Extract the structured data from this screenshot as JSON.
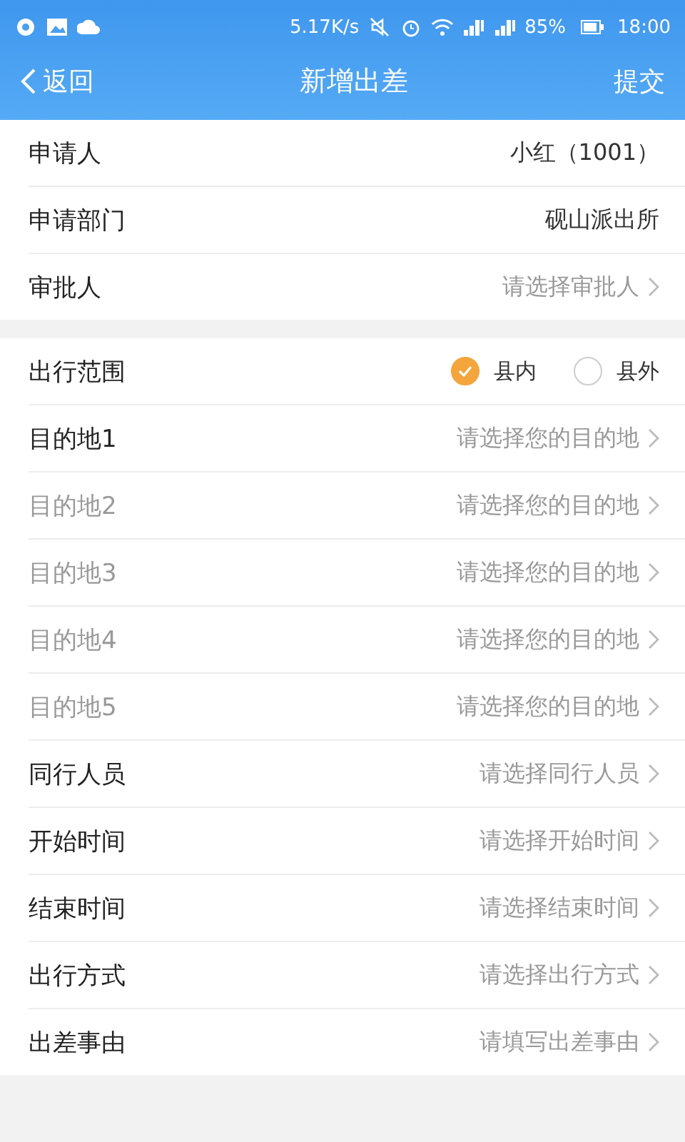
{
  "status_bar": {
    "speed": "5.17K/s",
    "battery": "85%",
    "time": "18:00"
  },
  "header": {
    "back": "返回",
    "title": "新增出差",
    "action": "提交"
  },
  "sections": [
    {
      "rows": [
        {
          "kind": "value",
          "label": "申请人",
          "value": "小红（1001）",
          "disabled": false
        },
        {
          "kind": "value",
          "label": "申请部门",
          "value": "砚山派出所",
          "disabled": false
        },
        {
          "kind": "select",
          "label": "审批人",
          "placeholder": "请选择审批人",
          "disabled": false
        }
      ]
    },
    {
      "rows": [
        {
          "kind": "radio",
          "label": "出行范围",
          "options": [
            {
              "label": "县内",
              "selected": true
            },
            {
              "label": "县外",
              "selected": false
            }
          ],
          "disabled": false
        },
        {
          "kind": "select",
          "label": "目的地1",
          "placeholder": "请选择您的目的地",
          "disabled": false
        },
        {
          "kind": "select",
          "label": "目的地2",
          "placeholder": "请选择您的目的地",
          "disabled": true
        },
        {
          "kind": "select",
          "label": "目的地3",
          "placeholder": "请选择您的目的地",
          "disabled": true
        },
        {
          "kind": "select",
          "label": "目的地4",
          "placeholder": "请选择您的目的地",
          "disabled": true
        },
        {
          "kind": "select",
          "label": "目的地5",
          "placeholder": "请选择您的目的地",
          "disabled": true
        },
        {
          "kind": "select",
          "label": "同行人员",
          "placeholder": "请选择同行人员",
          "disabled": false
        },
        {
          "kind": "select",
          "label": "开始时间",
          "placeholder": "请选择开始时间",
          "disabled": false
        },
        {
          "kind": "select",
          "label": "结束时间",
          "placeholder": "请选择结束时间",
          "disabled": false
        },
        {
          "kind": "select",
          "label": "出行方式",
          "placeholder": "请选择出行方式",
          "disabled": false
        },
        {
          "kind": "select",
          "label": "出差事由",
          "placeholder": "请填写出差事由",
          "disabled": false
        }
      ]
    }
  ]
}
